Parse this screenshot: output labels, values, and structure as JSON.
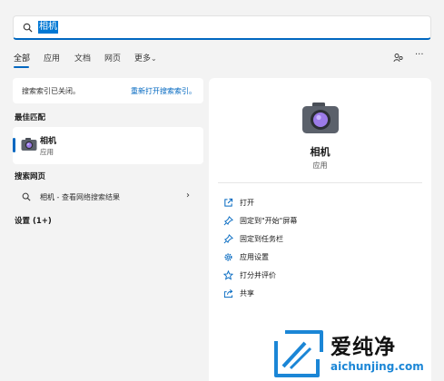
{
  "search": {
    "query": "相机"
  },
  "tabs": [
    "全部",
    "应用",
    "文档",
    "网页",
    "更多"
  ],
  "toolbar": {
    "more_chevron": "⌄",
    "ellipsis": "···"
  },
  "notice": {
    "text": "搜索索引已关闭。",
    "link": "重新打开搜索索引。"
  },
  "best_match": {
    "heading": "最佳匹配",
    "name": "相机",
    "type": "应用"
  },
  "web": {
    "heading": "搜索网页",
    "query": "相机",
    "suffix": " - 查看网络搜索结果",
    "chevron": "›"
  },
  "settings": {
    "heading": "设置 (1+)"
  },
  "detail": {
    "title": "相机",
    "type": "应用",
    "actions": [
      {
        "label": "打开",
        "icon": "open-icon"
      },
      {
        "label": "固定到\"开始\"屏幕",
        "icon": "pin-icon"
      },
      {
        "label": "固定到任务栏",
        "icon": "pin-icon"
      },
      {
        "label": "应用设置",
        "icon": "gear-icon"
      },
      {
        "label": "打分并评价",
        "icon": "star-icon"
      },
      {
        "label": "共享",
        "icon": "share-icon"
      }
    ]
  },
  "watermark": {
    "cn": "爱纯净",
    "en": "aichunjing.com"
  },
  "colors": {
    "accent": "#0067c0",
    "panel": "#ffffff",
    "background": "#f3f3f3",
    "watermark_blue": "#1b86d6"
  }
}
